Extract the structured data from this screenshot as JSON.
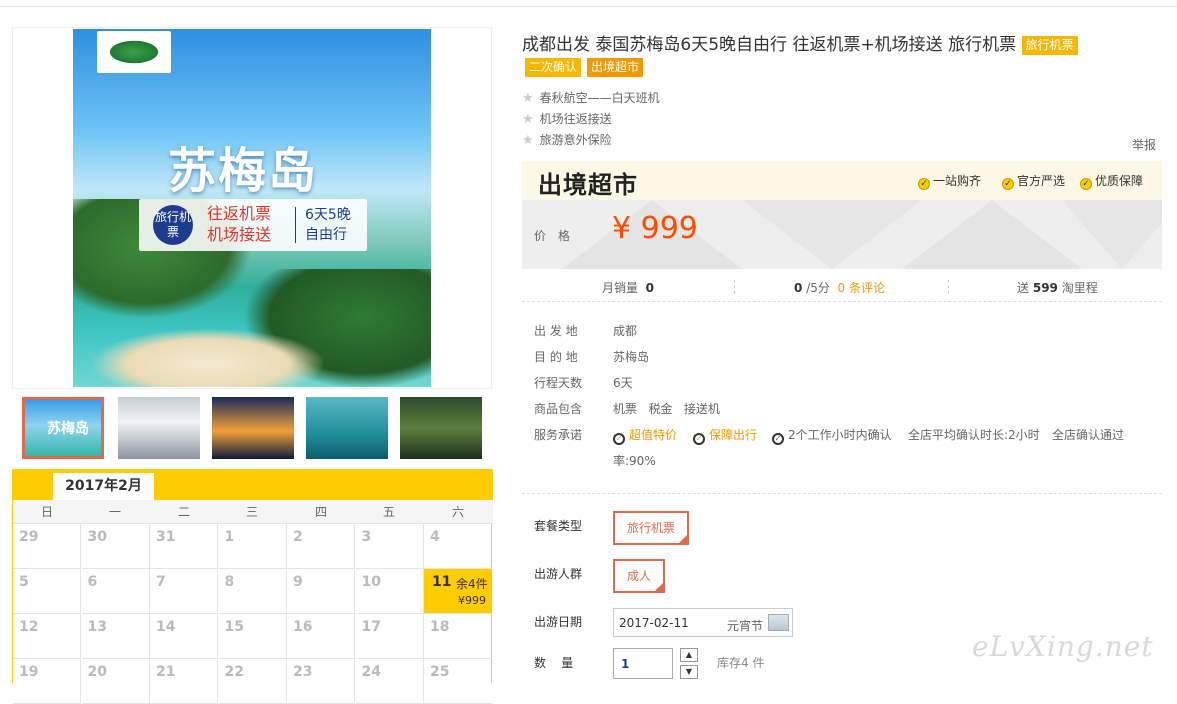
{
  "hero": {
    "destination": "苏梅岛",
    "badge": "旅行机票",
    "mid_line1": "往返机票",
    "mid_line2": "机场接送",
    "right_line1": "6天5晚",
    "right_line2": "自由行"
  },
  "thumbs": [
    {
      "label": "苏梅岛"
    },
    {
      "label": ""
    },
    {
      "label": ""
    },
    {
      "label": ""
    },
    {
      "label": ""
    }
  ],
  "calendar": {
    "month": "2017年2月",
    "weekdays": [
      "日",
      "一",
      "二",
      "三",
      "四",
      "五",
      "六"
    ],
    "rows": [
      [
        "29",
        "30",
        "31",
        "1",
        "2",
        "3",
        "4"
      ],
      [
        "5",
        "6",
        "7",
        "8",
        "9",
        "10",
        "11"
      ],
      [
        "12",
        "13",
        "14",
        "15",
        "16",
        "17",
        "18"
      ],
      [
        "19",
        "20",
        "21",
        "22",
        "23",
        "24",
        "25"
      ]
    ],
    "available": {
      "day": "11",
      "stock": "余4件",
      "price": "¥999"
    }
  },
  "product": {
    "title": "成都出发 泰国苏梅岛6天5晚自由行 往返机票+机场接送 旅行机票",
    "title_tag": "旅行机票",
    "tags": [
      "二次确认",
      "出境超市"
    ],
    "features": [
      "春秋航空——白天班机",
      "机场往返接送",
      "旅游意外保险"
    ],
    "report": "举报"
  },
  "pricebox": {
    "brand": "出境超市",
    "guarantees": [
      "一站购齐",
      "官方严选",
      "优质保障"
    ],
    "price_label": "价格",
    "price": "¥ 999"
  },
  "stats": {
    "sales_label": "月销量",
    "sales": "0",
    "score": "0",
    "score_unit": "/5分",
    "comments": "0 条评论",
    "mileage_prefix": "送",
    "mileage": "599",
    "mileage_suffix": "淘里程"
  },
  "info": {
    "departure_label": "出 发 地",
    "departure": "成都",
    "destination_label": "目 的 地",
    "destination": "苏梅岛",
    "days_label": "行程天数",
    "days": "6天",
    "includes_label": "商品包含",
    "includes": "机票   税金   接送机",
    "service_label": "服务承诺",
    "services": [
      "超值特价",
      "保障出行",
      "2个工作小时内确认"
    ],
    "confirm_avg": "全店平均确认时长:2小时",
    "confirm_rate_a": "全店确认通过",
    "confirm_rate_b": "率:90%"
  },
  "options": {
    "package_label": "套餐类型",
    "package_value": "旅行机票",
    "traveler_label": "出游人群",
    "traveler_value": "成人",
    "date_label": "出游日期",
    "date_value": "2017-02-11",
    "date_festival": "元宵节",
    "qty_label": "数    量",
    "qty_value": "1",
    "stock": "库存4 件"
  },
  "watermark": "eLvXing.net",
  "colors": {
    "accent": "#ffcc00",
    "price": "#ff4a00",
    "selected": "#e06a4e",
    "tag": "#f5b800"
  }
}
